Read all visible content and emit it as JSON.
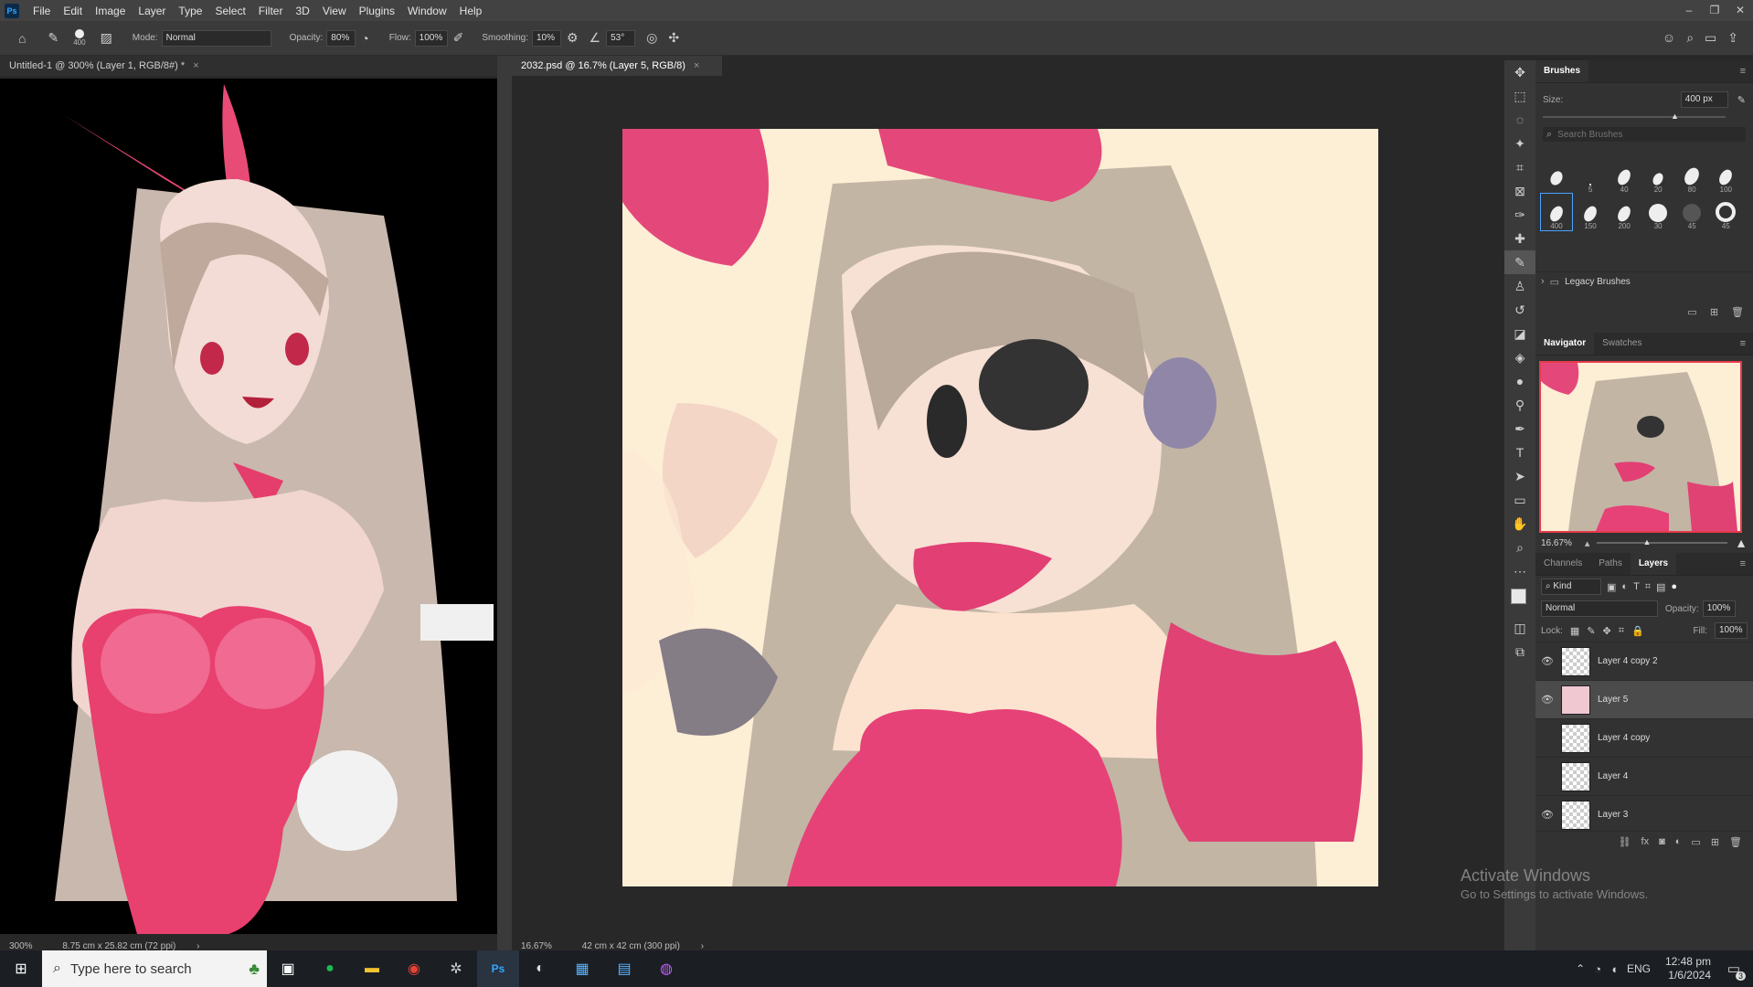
{
  "app": {
    "logo": "Ps"
  },
  "menu": [
    "File",
    "Edit",
    "Image",
    "Layer",
    "Type",
    "Select",
    "Filter",
    "3D",
    "View",
    "Plugins",
    "Window",
    "Help"
  ],
  "window_controls": [
    "–",
    "❐",
    "✕"
  ],
  "options": {
    "brush_size": "400",
    "mode_label": "Mode:",
    "mode_value": "Normal",
    "opacity_label": "Opacity:",
    "opacity_value": "80%",
    "flow_label": "Flow:",
    "flow_value": "100%",
    "smoothing_label": "Smoothing:",
    "smoothing_value": "10%",
    "angle_value": "53°"
  },
  "tabs": {
    "left": "Untitled-1 @ 300% (Layer 1, RGB/8#) *",
    "right": "2032.psd @ 16.7% (Layer 5, RGB/8)",
    "close": "×"
  },
  "status": {
    "left_zoom": "300%",
    "left_info": "8.75 cm x 25.82 cm (72 ppi)",
    "right_zoom": "16.67%",
    "right_info": "42 cm x 42 cm (300 ppi)",
    "arrow": "›"
  },
  "brushes": {
    "title": "Brushes",
    "size_label": "Size:",
    "size_value": "400 px",
    "search_placeholder": "Search Brushes",
    "presets": [
      "",
      "5",
      "40",
      "20",
      "80",
      "100",
      "400",
      "150",
      "200",
      "30",
      "45",
      "45"
    ],
    "folder": "Legacy Brushes"
  },
  "navigator": {
    "tab_active": "Navigator",
    "tab_other": "Swatches",
    "zoom": "16.67%"
  },
  "layers_panel": {
    "tabs": [
      "Channels",
      "Paths",
      "Layers"
    ],
    "kind": "Kind",
    "blend": "Normal",
    "opacity_label": "Opacity:",
    "opacity_value": "100%",
    "lock_label": "Lock:",
    "fill_label": "Fill:",
    "fill_value": "100%",
    "layers": [
      {
        "name": "Layer 4 copy 2",
        "visible": true
      },
      {
        "name": "Layer 5",
        "visible": true,
        "selected": true
      },
      {
        "name": "Layer 4 copy",
        "visible": false
      },
      {
        "name": "Layer 4",
        "visible": false
      },
      {
        "name": "Layer 3",
        "visible": true
      }
    ]
  },
  "watermark": {
    "line1": "Activate Windows",
    "line2": "Go to Settings to activate Windows."
  },
  "taskbar": {
    "search_placeholder": "Type here to search",
    "time": "12:48 pm",
    "date": "1/6/2024",
    "lang": "ENG",
    "notifications": "3"
  }
}
